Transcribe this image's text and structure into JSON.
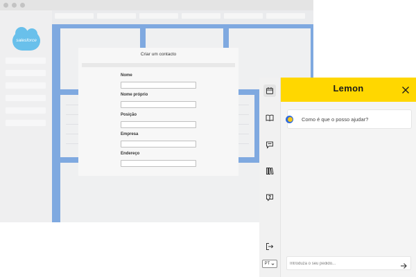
{
  "browser": {
    "brand": "salesforce"
  },
  "modal": {
    "title": "Criar um contacto",
    "fields": [
      {
        "label": "Nome",
        "value": ""
      },
      {
        "label": "Nome próprio",
        "value": ""
      },
      {
        "label": "Posição",
        "value": ""
      },
      {
        "label": "Empresa",
        "value": ""
      },
      {
        "label": "Endereço",
        "value": ""
      }
    ]
  },
  "lemon": {
    "brand": "Lemon",
    "rail_icons": [
      "calendar-icon",
      "book-icon",
      "chat-icon",
      "library-icon",
      "help-icon",
      "logout-icon"
    ],
    "language": "PT",
    "bot_message": "Como é que o posso ajudar?",
    "prompt_placeholder": "Introduza o seu pedido...",
    "colors": {
      "header": "#ffd700",
      "salesforce_blue": "#1a9ee0",
      "band_blue": "#3b7bcf"
    }
  }
}
